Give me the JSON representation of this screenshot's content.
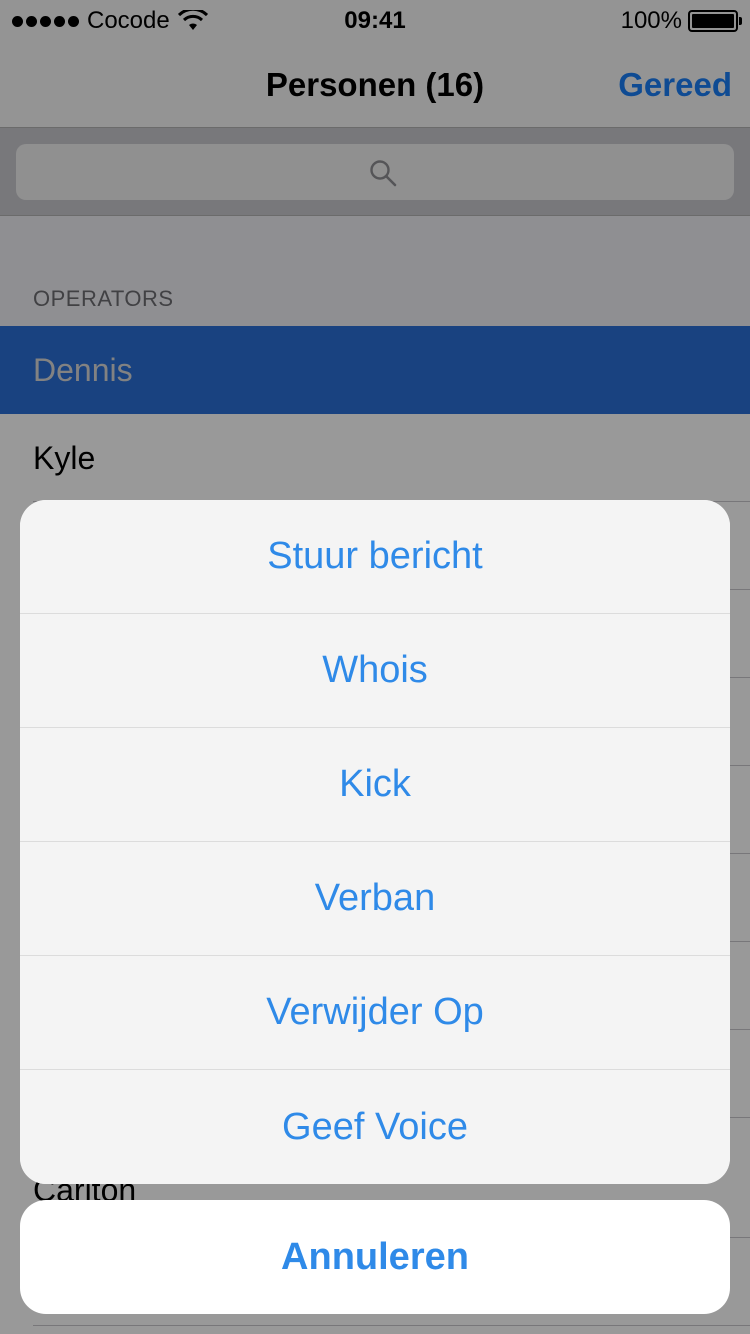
{
  "status_bar": {
    "carrier": "Cocode",
    "time": "09:41",
    "battery": "100%"
  },
  "nav": {
    "title": "Personen (16)",
    "done_label": "Gereed"
  },
  "search": {
    "icon": "search-icon"
  },
  "table": {
    "section_title": "OPERATORS",
    "rows": [
      {
        "label": "Dennis",
        "selected": true
      },
      {
        "label": "Kyle",
        "selected": false
      },
      {
        "label": "Carlton",
        "selected": false
      }
    ]
  },
  "action_sheet": {
    "actions": [
      "Stuur bericht",
      "Whois",
      "Kick",
      "Verban",
      "Verwijder Op",
      "Geef Voice"
    ],
    "cancel_label": "Annuleren"
  },
  "colors": {
    "accent": "#1a7ef5",
    "selection": "#2b6fd6",
    "action_text": "#2f8ae8"
  }
}
